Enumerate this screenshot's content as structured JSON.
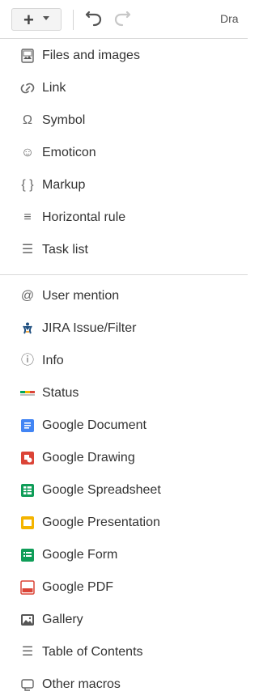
{
  "toolbar": {
    "insert_symbol": "+",
    "partial_label": "Dra"
  },
  "menu": {
    "group1": [
      {
        "label": "Files and images",
        "icon": "image-file-icon"
      },
      {
        "label": "Link",
        "icon": "link-icon"
      },
      {
        "label": "Symbol",
        "icon": "omega-icon",
        "glyph": "Ω"
      },
      {
        "label": "Emoticon",
        "icon": "emoticon-icon",
        "glyph": "☺"
      },
      {
        "label": "Markup",
        "icon": "markup-icon",
        "glyph": "{ }"
      },
      {
        "label": "Horizontal rule",
        "icon": "horizontal-rule-icon",
        "glyph": "≡"
      },
      {
        "label": "Task list",
        "icon": "task-list-icon",
        "glyph": "☰"
      }
    ],
    "group2": [
      {
        "label": "User mention",
        "icon": "at-icon",
        "glyph": "@"
      },
      {
        "label": "JIRA Issue/Filter",
        "icon": "jira-icon"
      },
      {
        "label": "Info",
        "icon": "info-icon",
        "glyph": "ⓘ"
      },
      {
        "label": "Status",
        "icon": "status-icon"
      },
      {
        "label": "Google Document",
        "icon": "google-document-icon",
        "color": "#4285f4"
      },
      {
        "label": "Google Drawing",
        "icon": "google-drawing-icon",
        "color": "#db4437"
      },
      {
        "label": "Google Spreadsheet",
        "icon": "google-spreadsheet-icon",
        "color": "#0f9d58"
      },
      {
        "label": "Google Presentation",
        "icon": "google-presentation-icon",
        "color": "#f4b400"
      },
      {
        "label": "Google Form",
        "icon": "google-form-icon",
        "color": "#0f9d58"
      },
      {
        "label": "Google PDF",
        "icon": "google-pdf-icon",
        "color": "#db4437"
      },
      {
        "label": "Gallery",
        "icon": "gallery-icon"
      },
      {
        "label": "Table of Contents",
        "icon": "table-of-contents-icon",
        "glyph": "☰"
      },
      {
        "label": "Other macros",
        "icon": "other-macros-icon"
      }
    ]
  },
  "colors": {
    "divider": "#d9d9d9",
    "text": "#333333",
    "icon_gray": "#666666",
    "status_green": "#00a65a",
    "status_yellow": "#f4b400",
    "status_red": "#db4437"
  }
}
